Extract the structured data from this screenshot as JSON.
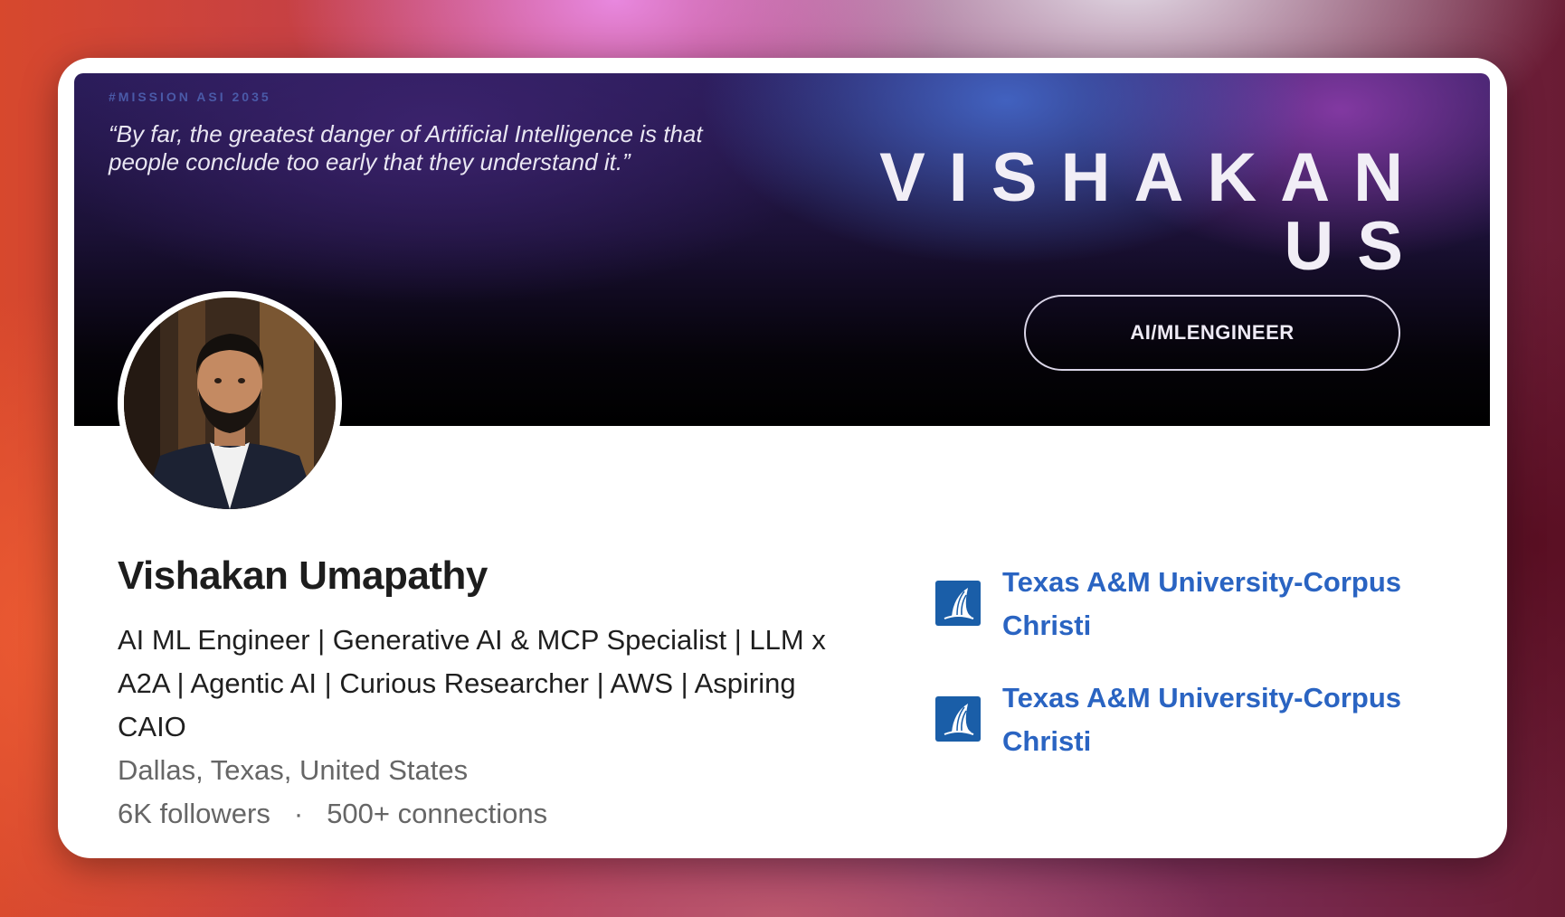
{
  "banner": {
    "hashtag": "#MISSION ASI 2035",
    "quote": "“By far, the greatest danger of Artificial Intelligence is that people conclude too early that they understand it.”",
    "name_line1": "VISHAKAN",
    "name_line2": "US",
    "role_pill": "AI/MLENGINEER"
  },
  "profile": {
    "name": "Vishakan Umapathy",
    "headline": "AI ML Engineer | Generative AI & MCP Specialist | LLM x A2A | Agentic AI | Curious Researcher | AWS | Aspiring CAIO",
    "location": "Dallas, Texas, United States",
    "followers": "6K followers",
    "separator": "·",
    "connections": "500+ connections"
  },
  "education": [
    {
      "name": "Texas A&M University-Corpus Christi",
      "icon": "university-logo-icon"
    },
    {
      "name": "Texas A&M University-Corpus Christi",
      "icon": "university-logo-icon"
    }
  ],
  "colors": {
    "link": "#2a64c2",
    "logo_bg": "#1a5ea8",
    "text_primary": "#1d1d1d",
    "text_secondary": "#666666"
  }
}
